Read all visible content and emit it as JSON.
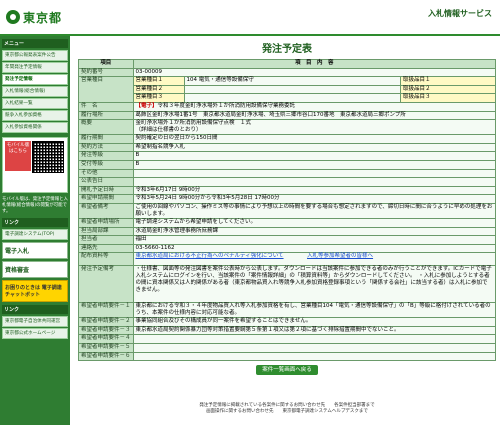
{
  "header": {
    "logo_text": "東京都",
    "site_title": "入札情報サービス"
  },
  "sidebar": {
    "menu_title": "メニュー",
    "menu_items": [
      "東京都公報発表案件公告",
      "年間発注予定情報",
      "発注予定情報",
      "入札情報(総合情報)",
      "入札結果一覧",
      "競争入札参加資格",
      "入札参加資格関係"
    ],
    "mobile_label": "モバイル版はこちら",
    "mobile_note": "モバイル版は、発注予定情報と入札情報(総合情報)の閲覧が可能です。",
    "link_title": "リンク",
    "link_items": [
      "電子調達システム(TOP)",
      "電子入札",
      "資格審査"
    ],
    "consult_label": "お困りのときは 電子調達チャットボット",
    "footer_title": "リンク",
    "footer_links": [
      "東京都電子自治体共同運営",
      "東京都公式ホームページ"
    ]
  },
  "main": {
    "title": "発注予定表",
    "col_item": "項目",
    "col_content": "項　目　内　容",
    "contract_no_label": "契約番号",
    "contract_no": "03-00009",
    "biz_label": "営業種目",
    "biz_rows": [
      {
        "name": "営業種目１",
        "value": "104 電気・通信等設備保守",
        "sub": "取扱品目１",
        "subval": ""
      },
      {
        "name": "営業種目２",
        "value": "",
        "sub": "取扱品目２",
        "subval": ""
      },
      {
        "name": "営業種目３",
        "value": "",
        "sub": "取扱品目３",
        "subval": ""
      }
    ],
    "name_label": "件　名",
    "name_badge": "【電子】",
    "name_value": "令和３年度金町浄水場外１か所消防用設備保守業務委託",
    "place_label": "履行場所",
    "place_value": "葛飾区金町浄水場1番1号　東京都水道局金町浄水場、埼玉県三郷市谷口170番地　東京都水道局三郷ポンプ所",
    "summary_label": "概要",
    "summary_line1": "金町浄水場外１か所消防用設備保守点検　１式",
    "summary_line2": "（詳細は仕様書のとおり）",
    "period_label": "履行期間",
    "period_value": "契約確定の日の翌日から150日間",
    "method_label": "契約方法",
    "method_value": "希望制指名競争入札",
    "dept_label": "発注等級",
    "dept_value": "B",
    "rank_label": "受付等級",
    "rank_value": "B",
    "other_label": "その他",
    "other_value": "",
    "announce_label": "公表告日",
    "announce_value": "",
    "open_label": "開札予定日時",
    "open_value": "令和3年6月17日 9時00分",
    "apply_period_label": "希望申請期間",
    "apply_period_value": "令和3年5月24日 9時00分から令和3年5月28日 17時00分",
    "apply_notes_label": "希望者備考",
    "apply_notes_value": "ご使用の回線やパソコン、操作ミス等の事情により予想以上の時間を要する場合も想定されますので、締切日時に間に合うように早めの処理をお願いします。",
    "apply_way_label": "希望者申請場所",
    "apply_way_value": "電子調達システムから希望申請をしてください。",
    "contact_dept_label": "担当局部課",
    "contact_dept_value": "水道局金町浄水管理事務所庶務課",
    "person_label": "担当者",
    "person_value": "福田",
    "tel_label": "連絡先",
    "tel_value": "03-5660-1162",
    "doc_label": "配布資料等",
    "doc_link1": "東京都水道局における不正行為へのペナルティ強化について",
    "doc_link2": "入札等参加希望者の皆様へ",
    "notes_label": "発注予定備考",
    "notes_value": "・仕様書、図面等の発注図書を案件公表時から公表します。ダウンロードは当該案件に参加できる者のみが行うことができます。ICカードで電子入札システムにログインを行い、当該案件の「案件情報詳細」の「積算資料等」からダウンロードしてください。　・入札に参加しようとする者の間に資本関係又は人的関係がある者（東京都物品買入れ等競争入札参加資格登録事項という「関係する会社」に該当する者）は入札に参加できません。",
    "req_rows": [
      {
        "label": "希望者申請要件－１",
        "value": "東京都における令和３・４年度物品買入れ等入札参加資格を有し、営業種目104「電気・通信等設備保守」の「B」等級に格付けされている者のうち、本案件の仕様内容に対応可能な者。"
      },
      {
        "label": "希望者申請要件－２",
        "value": "事業協同組合及びその構成員が同一案件を希望することはできません。"
      },
      {
        "label": "希望者申請要件－３",
        "value": "東京都水道局契約関係暴力団等対策措置要綱第５条第１項又は第２項に基づく排除措置期間中でないこと。"
      },
      {
        "label": "希望者申請要件－４",
        "value": ""
      },
      {
        "label": "希望者申請要件－５",
        "value": ""
      },
      {
        "label": "希望者申請要件－６",
        "value": ""
      }
    ],
    "back_label": "案件一覧画面へ戻る"
  },
  "footer": {
    "line1": "発注予定情報に掲載されている各案件に関するお問い合わせ先　　各案件担当部署まで",
    "line2": "画面操作に関するお問い合わせ先　　東京都電子調達システムヘルプデスクまで"
  },
  "colors": {
    "brand": "#2f7d32",
    "header_bg": "#c7e3c7"
  }
}
